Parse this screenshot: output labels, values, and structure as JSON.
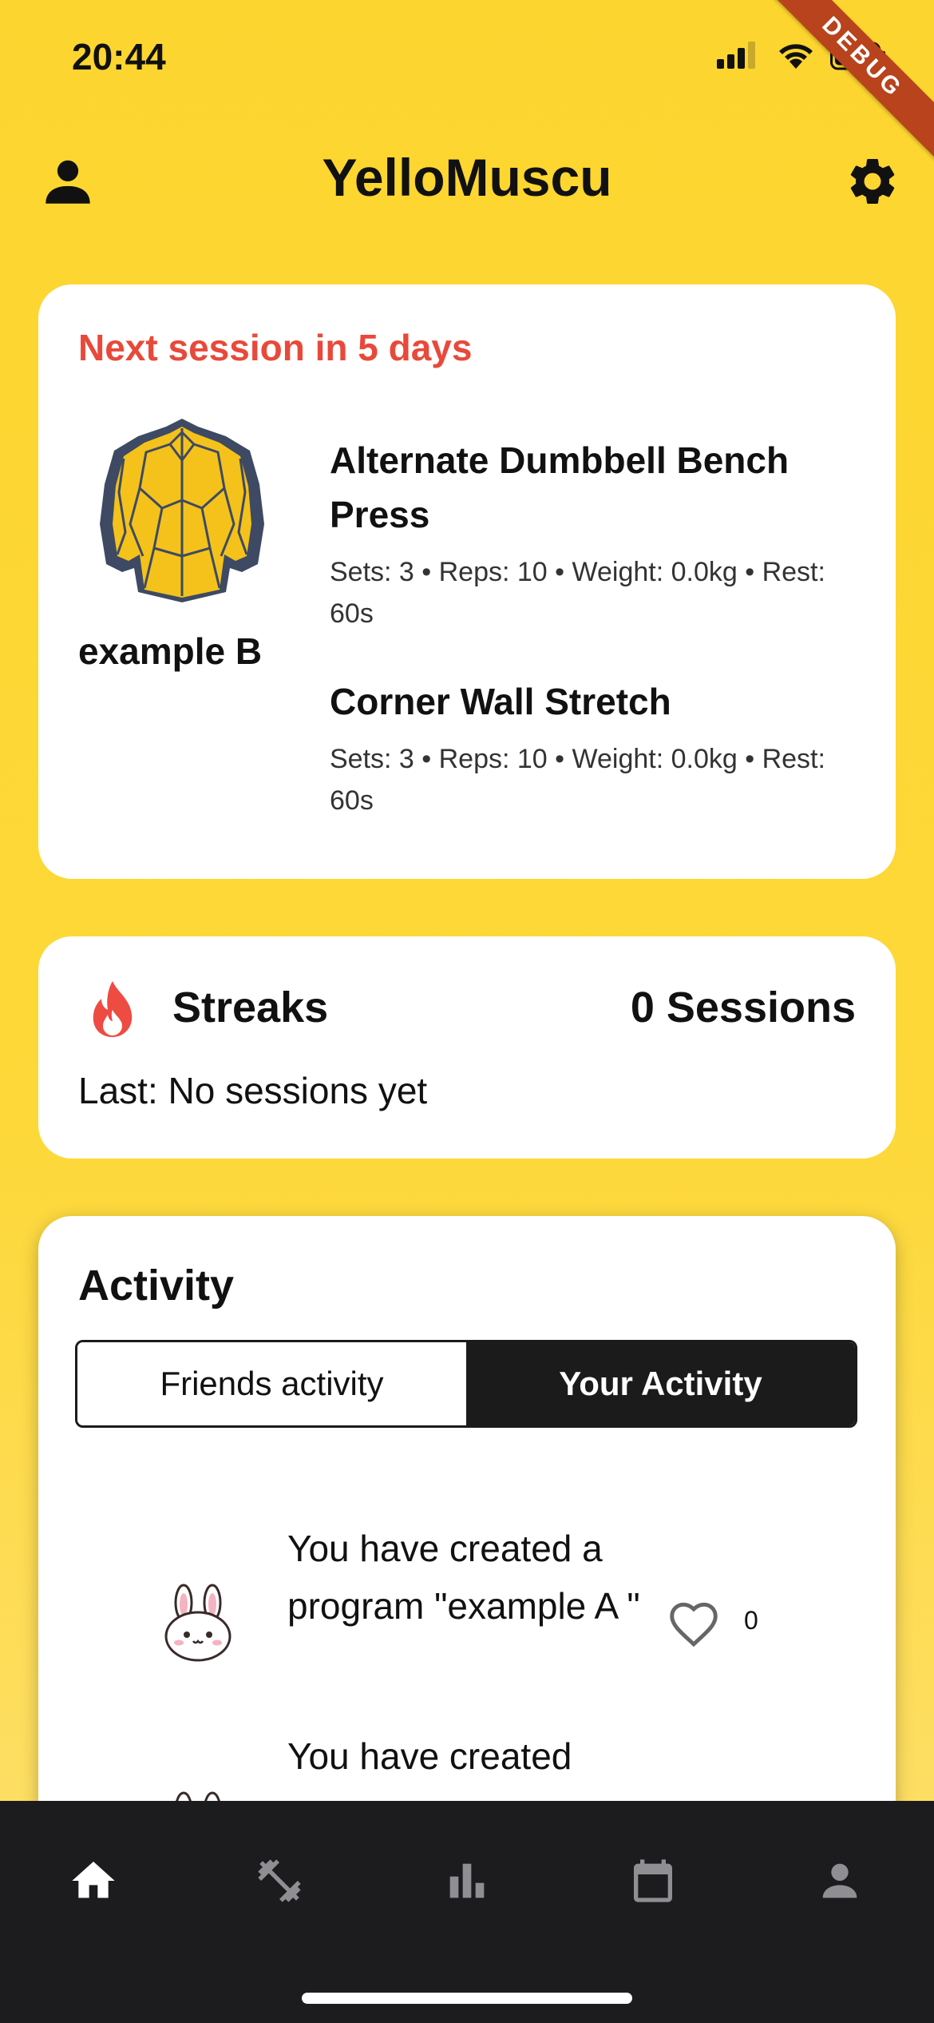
{
  "status_bar": {
    "time": "20:44",
    "debug_label": "DEBUG"
  },
  "app_bar": {
    "title": "YelloMuscu",
    "left_icon": "person-icon",
    "right_icon": "gear-icon"
  },
  "next_session": {
    "heading": "Next session in 5 days",
    "program_name": "example B",
    "program_image": "muscle-torso-icon",
    "exercises": [
      {
        "title": "Alternate Dumbbell Bench Press",
        "meta": "Sets: 3 • Reps: 10 • Weight: 0.0kg • Rest: 60s"
      },
      {
        "title": "Corner Wall Stretch",
        "meta": "Sets: 3 • Reps: 10 • Weight: 0.0kg • Rest: 60s"
      }
    ]
  },
  "streaks": {
    "icon": "flame-icon",
    "label": "Streaks",
    "count": "0 Sessions",
    "last": "Last: No sessions yet"
  },
  "activity": {
    "title": "Activity",
    "tabs": [
      {
        "label": "Friends activity",
        "selected": false
      },
      {
        "label": "Your Activity",
        "selected": true
      }
    ],
    "items": [
      {
        "avatar": "bunny-avatar-icon",
        "text": "You have created a program \"example A \"",
        "likes": "0"
      },
      {
        "avatar": "bunny-avatar-icon",
        "text": "You have created",
        "likes": ""
      }
    ]
  },
  "bottom_nav": {
    "items": [
      {
        "icon": "home-icon",
        "active": true
      },
      {
        "icon": "dumbbell-icon",
        "active": false
      },
      {
        "icon": "bar-chart-icon",
        "active": false
      },
      {
        "icon": "calendar-icon",
        "active": false
      },
      {
        "icon": "person-icon",
        "active": false
      }
    ]
  },
  "colors": {
    "background": "#FDD52F",
    "accent_red": "#E8493A",
    "nav_background": "#1C1C1E",
    "program_yellow": "#F4C21B"
  }
}
